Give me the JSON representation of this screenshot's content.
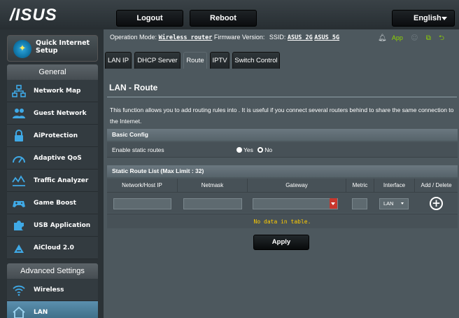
{
  "brand": {
    "logo_text": "/ISUS"
  },
  "topbar": {
    "logout_label": "Logout",
    "reboot_label": "Reboot",
    "language": "English"
  },
  "status": {
    "operation_mode_label": "Operation Mode:",
    "operation_mode_value": "Wireless router",
    "firmware_label": "Firmware Version:",
    "ssid_label": "SSID:",
    "ssid_2g": "ASUS_2G",
    "ssid_5g": "ASUS_5G",
    "app_label": "App"
  },
  "sidebar": {
    "quick_setup_label": "Quick Internet Setup",
    "general_header": "General",
    "general_items": [
      {
        "label": "Network Map"
      },
      {
        "label": "Guest Network"
      },
      {
        "label": "AiProtection"
      },
      {
        "label": "Adaptive QoS"
      },
      {
        "label": "Traffic Analyzer"
      },
      {
        "label": "Game Boost"
      },
      {
        "label": "USB Application"
      },
      {
        "label": "AiCloud 2.0"
      }
    ],
    "advanced_header": "Advanced Settings",
    "advanced_items": [
      {
        "label": "Wireless"
      },
      {
        "label": "LAN"
      }
    ]
  },
  "tabs": [
    {
      "label": "LAN IP"
    },
    {
      "label": "DHCP Server"
    },
    {
      "label": "Route"
    },
    {
      "label": "IPTV"
    },
    {
      "label": "Switch Control"
    }
  ],
  "page": {
    "title": "LAN - Route",
    "description": "This function allows you to add routing rules into . It is useful if you connect several routers behind to share the same connection to the Internet."
  },
  "basic_config": {
    "header": "Basic Config",
    "enable_static_label": "Enable static routes",
    "yes_label": "Yes",
    "no_label": "No",
    "selected": "No"
  },
  "route_list": {
    "header": "Static Route List (Max Limit : 32)",
    "columns": [
      "Network/Host IP",
      "Netmask",
      "Gateway",
      "Metric",
      "Interface",
      "Add / Delete"
    ],
    "interface_value": "LAN",
    "empty_message": "No data in table."
  },
  "actions": {
    "apply_label": "Apply"
  },
  "colors": {
    "accent": "#5b8fae",
    "empty_text": "#ffcc00",
    "dropdown": "#c8372d"
  }
}
